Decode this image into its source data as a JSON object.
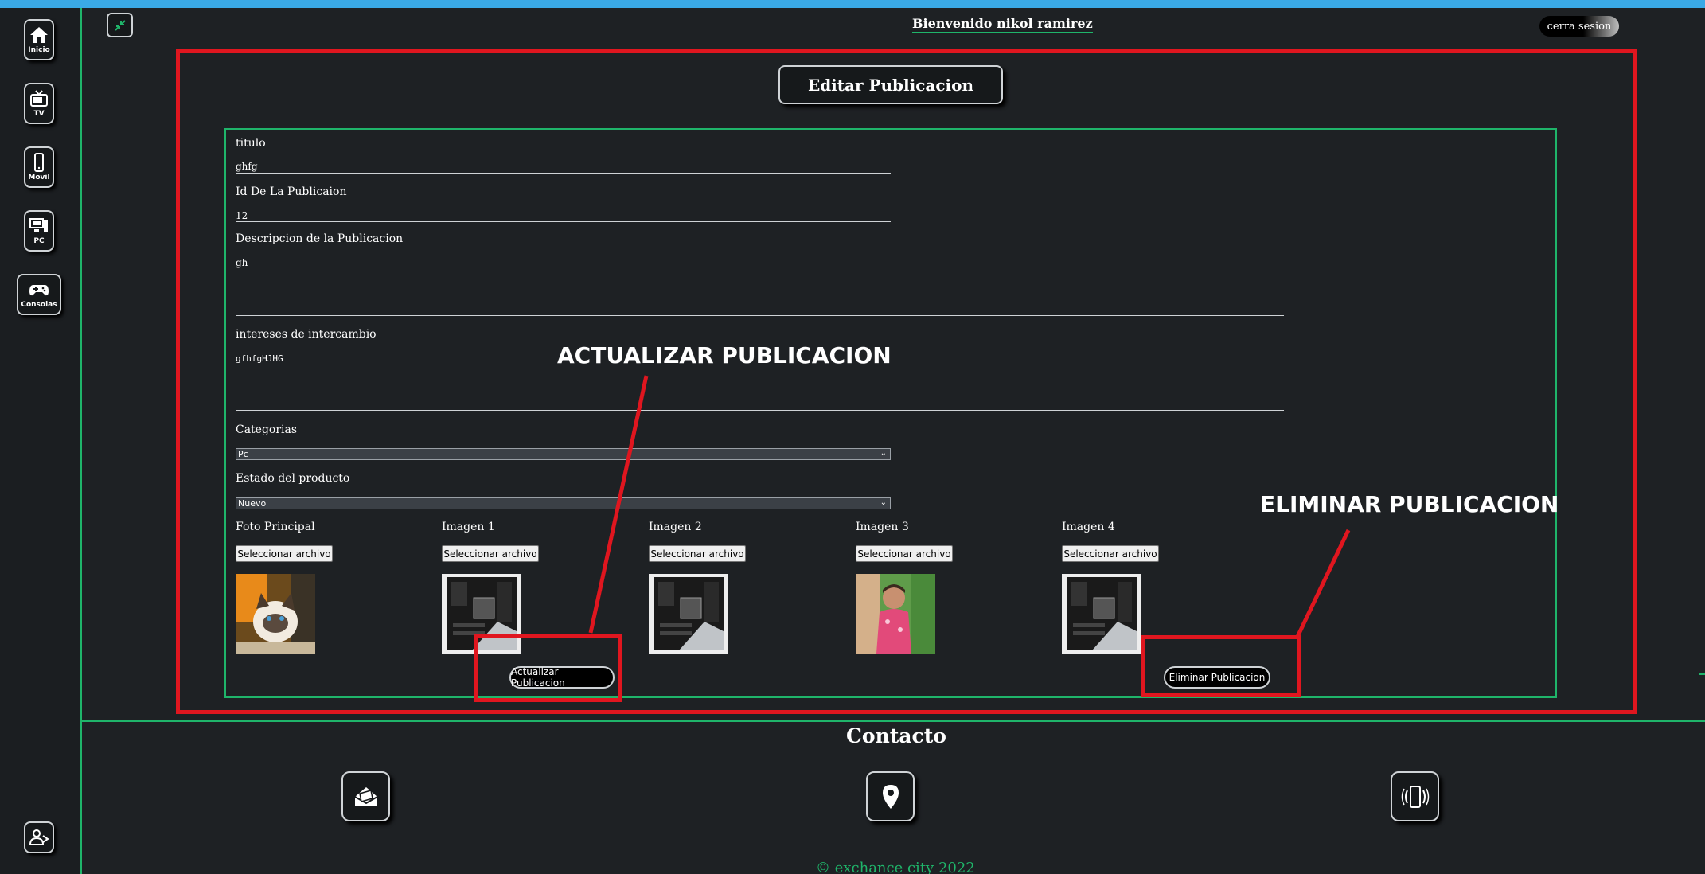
{
  "header": {
    "welcome_text": "Bienvenido nikol ramirez",
    "logout_label": "cerra sesion"
  },
  "sidebar": {
    "items": [
      {
        "label": "Inicio",
        "icon": "home-icon"
      },
      {
        "label": "TV",
        "icon": "tv-icon"
      },
      {
        "label": "Movil",
        "icon": "mobile-icon"
      },
      {
        "label": "PC",
        "icon": "pc-icon"
      },
      {
        "label": "Consolas",
        "icon": "gamepad-icon"
      }
    ],
    "bottom_icon": "user-icon"
  },
  "page": {
    "title": "Editar Publicacion"
  },
  "form": {
    "titulo_label": "titulo",
    "titulo_value": "ghfg",
    "id_label": "Id De La Publicaion",
    "id_value": "12",
    "descripcion_label": "Descripcion de la Publicacion",
    "descripcion_value": "gh",
    "intereses_label": "intereses de intercambio",
    "intereses_value": "gfhfgHJHG",
    "categorias_label": "Categorias",
    "categorias_value": "Pc",
    "estado_label": "Estado del producto",
    "estado_value": "Nuevo",
    "images": [
      {
        "label": "Foto Principal",
        "button": "Seleccionar archivo"
      },
      {
        "label": "Imagen 1",
        "button": "Seleccionar archivo"
      },
      {
        "label": "Imagen 2",
        "button": "Seleccionar archivo"
      },
      {
        "label": "Imagen 3",
        "button": "Seleccionar archivo"
      },
      {
        "label": "Imagen 4",
        "button": "Seleccionar archivo"
      }
    ],
    "update_button": "Actualizar Publicacion",
    "delete_button": "Eliminar Publicacion"
  },
  "annotations": {
    "update": "ACTUALIZAR PUBLICACION",
    "delete": "ELIMINAR PUBLICACION"
  },
  "footer": {
    "contact_title": "Contacto",
    "icons": [
      "mail-icon",
      "location-icon",
      "phone-icon"
    ],
    "copyright": "© exchance city 2022"
  },
  "colors": {
    "accent": "#1fb56a",
    "annotation_red": "#e0161f",
    "background": "#1e2124"
  }
}
